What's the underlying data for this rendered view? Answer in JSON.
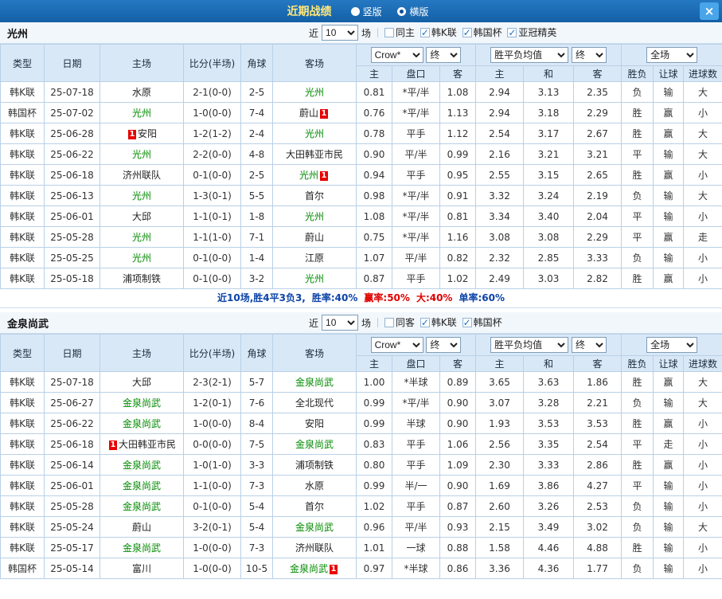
{
  "topbar": {
    "title": "近期战绩",
    "radios": [
      {
        "label": "竖版",
        "checked": false
      },
      {
        "label": "横版",
        "checked": true
      }
    ],
    "close": "×"
  },
  "columns": {
    "type": "类型",
    "date": "日期",
    "home": "主场",
    "score": "比分(半场)",
    "corner": "角球",
    "away": "客场",
    "sub": [
      "主",
      "盘口",
      "客",
      "主",
      "和",
      "客",
      "胜负",
      "让球",
      "进球数"
    ]
  },
  "controls": {
    "bookmaker": "Crow*",
    "final_label": "终",
    "avg_label": "胜平负均值",
    "scope": "全场"
  },
  "colors": {
    "league_k": "#01398e",
    "league_cup": "#3f6cc4",
    "win_red": "#e00000",
    "loss_green": "#008a00",
    "draw_blue": "#0033dd",
    "score_red": "#d50000",
    "focal_team_green": "#008a00"
  },
  "sections": [
    {
      "team": "光州",
      "filters": {
        "near_label": "近",
        "count": "10",
        "games_label": "场",
        "checks": [
          {
            "label": "同主",
            "checked": false
          },
          {
            "label": "韩K联",
            "checked": true
          },
          {
            "label": "韩国杯",
            "checked": true
          },
          {
            "label": "亚冠精英",
            "checked": true
          }
        ]
      },
      "rows": [
        {
          "league": "韩K联",
          "date": "25-07-18",
          "home": {
            "name": "水原"
          },
          "score": "2-1(0-0)",
          "corner": "2-5",
          "away": {
            "name": "光州",
            "focal": true
          },
          "o1": "0.81",
          "hcp": "*平/半",
          "o2": "1.08",
          "a1": "2.94",
          "a2": "3.13",
          "a3": "2.35",
          "res": "负",
          "let": "输",
          "goal": "大"
        },
        {
          "league": "韩国杯",
          "date": "25-07-02",
          "home": {
            "name": "光州",
            "focal": true
          },
          "score": "1-0(0-0)",
          "corner": "7-4",
          "away": {
            "name": "蔚山",
            "badge": "1",
            "badge_pos": "right"
          },
          "o1": "0.76",
          "hcp": "*平/半",
          "o2": "1.13",
          "a1": "2.94",
          "a2": "3.18",
          "a3": "2.29",
          "res": "胜",
          "let": "赢",
          "goal": "小"
        },
        {
          "league": "韩K联",
          "date": "25-06-28",
          "home": {
            "name": "安阳",
            "badge": "1",
            "badge_pos": "left"
          },
          "score": "1-2(1-2)",
          "corner": "2-4",
          "away": {
            "name": "光州",
            "focal": true
          },
          "o1": "0.78",
          "hcp": "平手",
          "o2": "1.12",
          "a1": "2.54",
          "a2": "3.17",
          "a3": "2.67",
          "res": "胜",
          "let": "赢",
          "goal": "大"
        },
        {
          "league": "韩K联",
          "date": "25-06-22",
          "home": {
            "name": "光州",
            "focal": true
          },
          "score": "2-2(0-0)",
          "corner": "4-8",
          "away": {
            "name": "大田韩亚市民"
          },
          "o1": "0.90",
          "hcp": "平/半",
          "o2": "0.99",
          "a1": "2.16",
          "a2": "3.21",
          "a3": "3.21",
          "res": "平",
          "let": "输",
          "goal": "大"
        },
        {
          "league": "韩K联",
          "date": "25-06-18",
          "home": {
            "name": "济州联队"
          },
          "score": "0-1(0-0)",
          "corner": "2-5",
          "away": {
            "name": "光州",
            "focal": true,
            "badge": "1",
            "badge_pos": "right"
          },
          "o1": "0.94",
          "hcp": "平手",
          "o2": "0.95",
          "a1": "2.55",
          "a2": "3.15",
          "a3": "2.65",
          "res": "胜",
          "let": "赢",
          "goal": "小"
        },
        {
          "league": "韩K联",
          "date": "25-06-13",
          "home": {
            "name": "光州",
            "focal": true
          },
          "score": "1-3(0-1)",
          "corner": "5-5",
          "away": {
            "name": "首尔"
          },
          "o1": "0.98",
          "hcp": "*平/半",
          "o2": "0.91",
          "a1": "3.32",
          "a2": "3.24",
          "a3": "2.19",
          "res": "负",
          "let": "输",
          "goal": "大"
        },
        {
          "league": "韩K联",
          "date": "25-06-01",
          "home": {
            "name": "大邱"
          },
          "score": "1-1(0-1)",
          "corner": "1-8",
          "away": {
            "name": "光州",
            "focal": true
          },
          "o1": "1.08",
          "hcp": "*平/半",
          "o2": "0.81",
          "a1": "3.34",
          "a2": "3.40",
          "a3": "2.04",
          "res": "平",
          "let": "输",
          "goal": "小"
        },
        {
          "league": "韩K联",
          "date": "25-05-28",
          "home": {
            "name": "光州",
            "focal": true
          },
          "score": "1-1(1-0)",
          "corner": "7-1",
          "away": {
            "name": "蔚山"
          },
          "o1": "0.75",
          "hcp": "*平/半",
          "o2": "1.16",
          "a1": "3.08",
          "a2": "3.08",
          "a3": "2.29",
          "res": "平",
          "let": "赢",
          "goal": "走"
        },
        {
          "league": "韩K联",
          "date": "25-05-25",
          "home": {
            "name": "光州",
            "focal": true
          },
          "score": "0-1(0-0)",
          "corner": "1-4",
          "away": {
            "name": "江原"
          },
          "o1": "1.07",
          "hcp": "平/半",
          "o2": "0.82",
          "a1": "2.32",
          "a2": "2.85",
          "a3": "3.33",
          "res": "负",
          "let": "输",
          "goal": "小"
        },
        {
          "league": "韩K联",
          "date": "25-05-18",
          "home": {
            "name": "浦项制铁"
          },
          "score": "0-1(0-0)",
          "corner": "3-2",
          "away": {
            "name": "光州",
            "focal": true
          },
          "o1": "0.87",
          "hcp": "平手",
          "o2": "1.02",
          "a1": "2.49",
          "a2": "3.03",
          "a3": "2.82",
          "res": "胜",
          "let": "赢",
          "goal": "小"
        }
      ],
      "summary": [
        {
          "text": "近10场,胜4平3负3,",
          "color": "#0b43a8"
        },
        {
          "text": "胜率:40%",
          "color": "#0b43a8"
        },
        {
          "text": "赢率:50%",
          "color": "#e00000"
        },
        {
          "text": "大:40%",
          "color": "#e00000"
        },
        {
          "text": "单率:60%",
          "color": "#0b43a8"
        }
      ]
    },
    {
      "team": "金泉尚武",
      "filters": {
        "near_label": "近",
        "count": "10",
        "games_label": "场",
        "checks": [
          {
            "label": "同客",
            "checked": false
          },
          {
            "label": "韩K联",
            "checked": true
          },
          {
            "label": "韩国杯",
            "checked": true
          }
        ]
      },
      "rows": [
        {
          "league": "韩K联",
          "date": "25-07-18",
          "home": {
            "name": "大邱"
          },
          "score": "2-3(2-1)",
          "corner": "5-7",
          "away": {
            "name": "金泉尚武",
            "focal": true
          },
          "o1": "1.00",
          "hcp": "*半球",
          "o2": "0.89",
          "a1": "3.65",
          "a2": "3.63",
          "a3": "1.86",
          "res": "胜",
          "let": "赢",
          "goal": "大"
        },
        {
          "league": "韩K联",
          "date": "25-06-27",
          "home": {
            "name": "金泉尚武",
            "focal": true
          },
          "score": "1-2(0-1)",
          "corner": "7-6",
          "away": {
            "name": "全北现代"
          },
          "o1": "0.99",
          "hcp": "*平/半",
          "o2": "0.90",
          "a1": "3.07",
          "a2": "3.28",
          "a3": "2.21",
          "res": "负",
          "let": "输",
          "goal": "大"
        },
        {
          "league": "韩K联",
          "date": "25-06-22",
          "home": {
            "name": "金泉尚武",
            "focal": true
          },
          "score": "1-0(0-0)",
          "corner": "8-4",
          "away": {
            "name": "安阳"
          },
          "o1": "0.99",
          "hcp": "半球",
          "o2": "0.90",
          "a1": "1.93",
          "a2": "3.53",
          "a3": "3.53",
          "res": "胜",
          "let": "赢",
          "goal": "小"
        },
        {
          "league": "韩K联",
          "date": "25-06-18",
          "home": {
            "name": "大田韩亚市民",
            "badge": "1",
            "badge_pos": "left"
          },
          "score": "0-0(0-0)",
          "corner": "7-5",
          "away": {
            "name": "金泉尚武",
            "focal": true
          },
          "o1": "0.83",
          "hcp": "平手",
          "o2": "1.06",
          "a1": "2.56",
          "a2": "3.35",
          "a3": "2.54",
          "res": "平",
          "let": "走",
          "goal": "小"
        },
        {
          "league": "韩K联",
          "date": "25-06-14",
          "home": {
            "name": "金泉尚武",
            "focal": true
          },
          "score": "1-0(1-0)",
          "corner": "3-3",
          "away": {
            "name": "浦项制铁"
          },
          "o1": "0.80",
          "hcp": "平手",
          "o2": "1.09",
          "a1": "2.30",
          "a2": "3.33",
          "a3": "2.86",
          "res": "胜",
          "let": "赢",
          "goal": "小"
        },
        {
          "league": "韩K联",
          "date": "25-06-01",
          "home": {
            "name": "金泉尚武",
            "focal": true
          },
          "score": "1-1(0-0)",
          "corner": "7-3",
          "away": {
            "name": "水原"
          },
          "o1": "0.99",
          "hcp": "半/一",
          "o2": "0.90",
          "a1": "1.69",
          "a2": "3.86",
          "a3": "4.27",
          "res": "平",
          "let": "输",
          "goal": "小"
        },
        {
          "league": "韩K联",
          "date": "25-05-28",
          "home": {
            "name": "金泉尚武",
            "focal": true
          },
          "score": "0-1(0-0)",
          "corner": "5-4",
          "away": {
            "name": "首尔"
          },
          "o1": "1.02",
          "hcp": "平手",
          "o2": "0.87",
          "a1": "2.60",
          "a2": "3.26",
          "a3": "2.53",
          "res": "负",
          "let": "输",
          "goal": "小"
        },
        {
          "league": "韩K联",
          "date": "25-05-24",
          "home": {
            "name": "蔚山"
          },
          "score": "3-2(0-1)",
          "corner": "5-4",
          "away": {
            "name": "金泉尚武",
            "focal": true
          },
          "o1": "0.96",
          "hcp": "平/半",
          "o2": "0.93",
          "a1": "2.15",
          "a2": "3.49",
          "a3": "3.02",
          "res": "负",
          "let": "输",
          "goal": "大"
        },
        {
          "league": "韩K联",
          "date": "25-05-17",
          "home": {
            "name": "金泉尚武",
            "focal": true
          },
          "score": "1-0(0-0)",
          "corner": "7-3",
          "away": {
            "name": "济州联队"
          },
          "o1": "1.01",
          "hcp": "一球",
          "o2": "0.88",
          "a1": "1.58",
          "a2": "4.46",
          "a3": "4.88",
          "res": "胜",
          "let": "输",
          "goal": "小"
        },
        {
          "league": "韩国杯",
          "date": "25-05-14",
          "home": {
            "name": "富川"
          },
          "score": "1-0(0-0)",
          "corner": "10-5",
          "away": {
            "name": "金泉尚武",
            "focal": true,
            "badge": "1",
            "badge_pos": "right"
          },
          "o1": "0.97",
          "hcp": "*半球",
          "o2": "0.86",
          "a1": "3.36",
          "a2": "4.36",
          "a3": "1.77",
          "res": "负",
          "let": "输",
          "goal": "小"
        }
      ]
    }
  ]
}
